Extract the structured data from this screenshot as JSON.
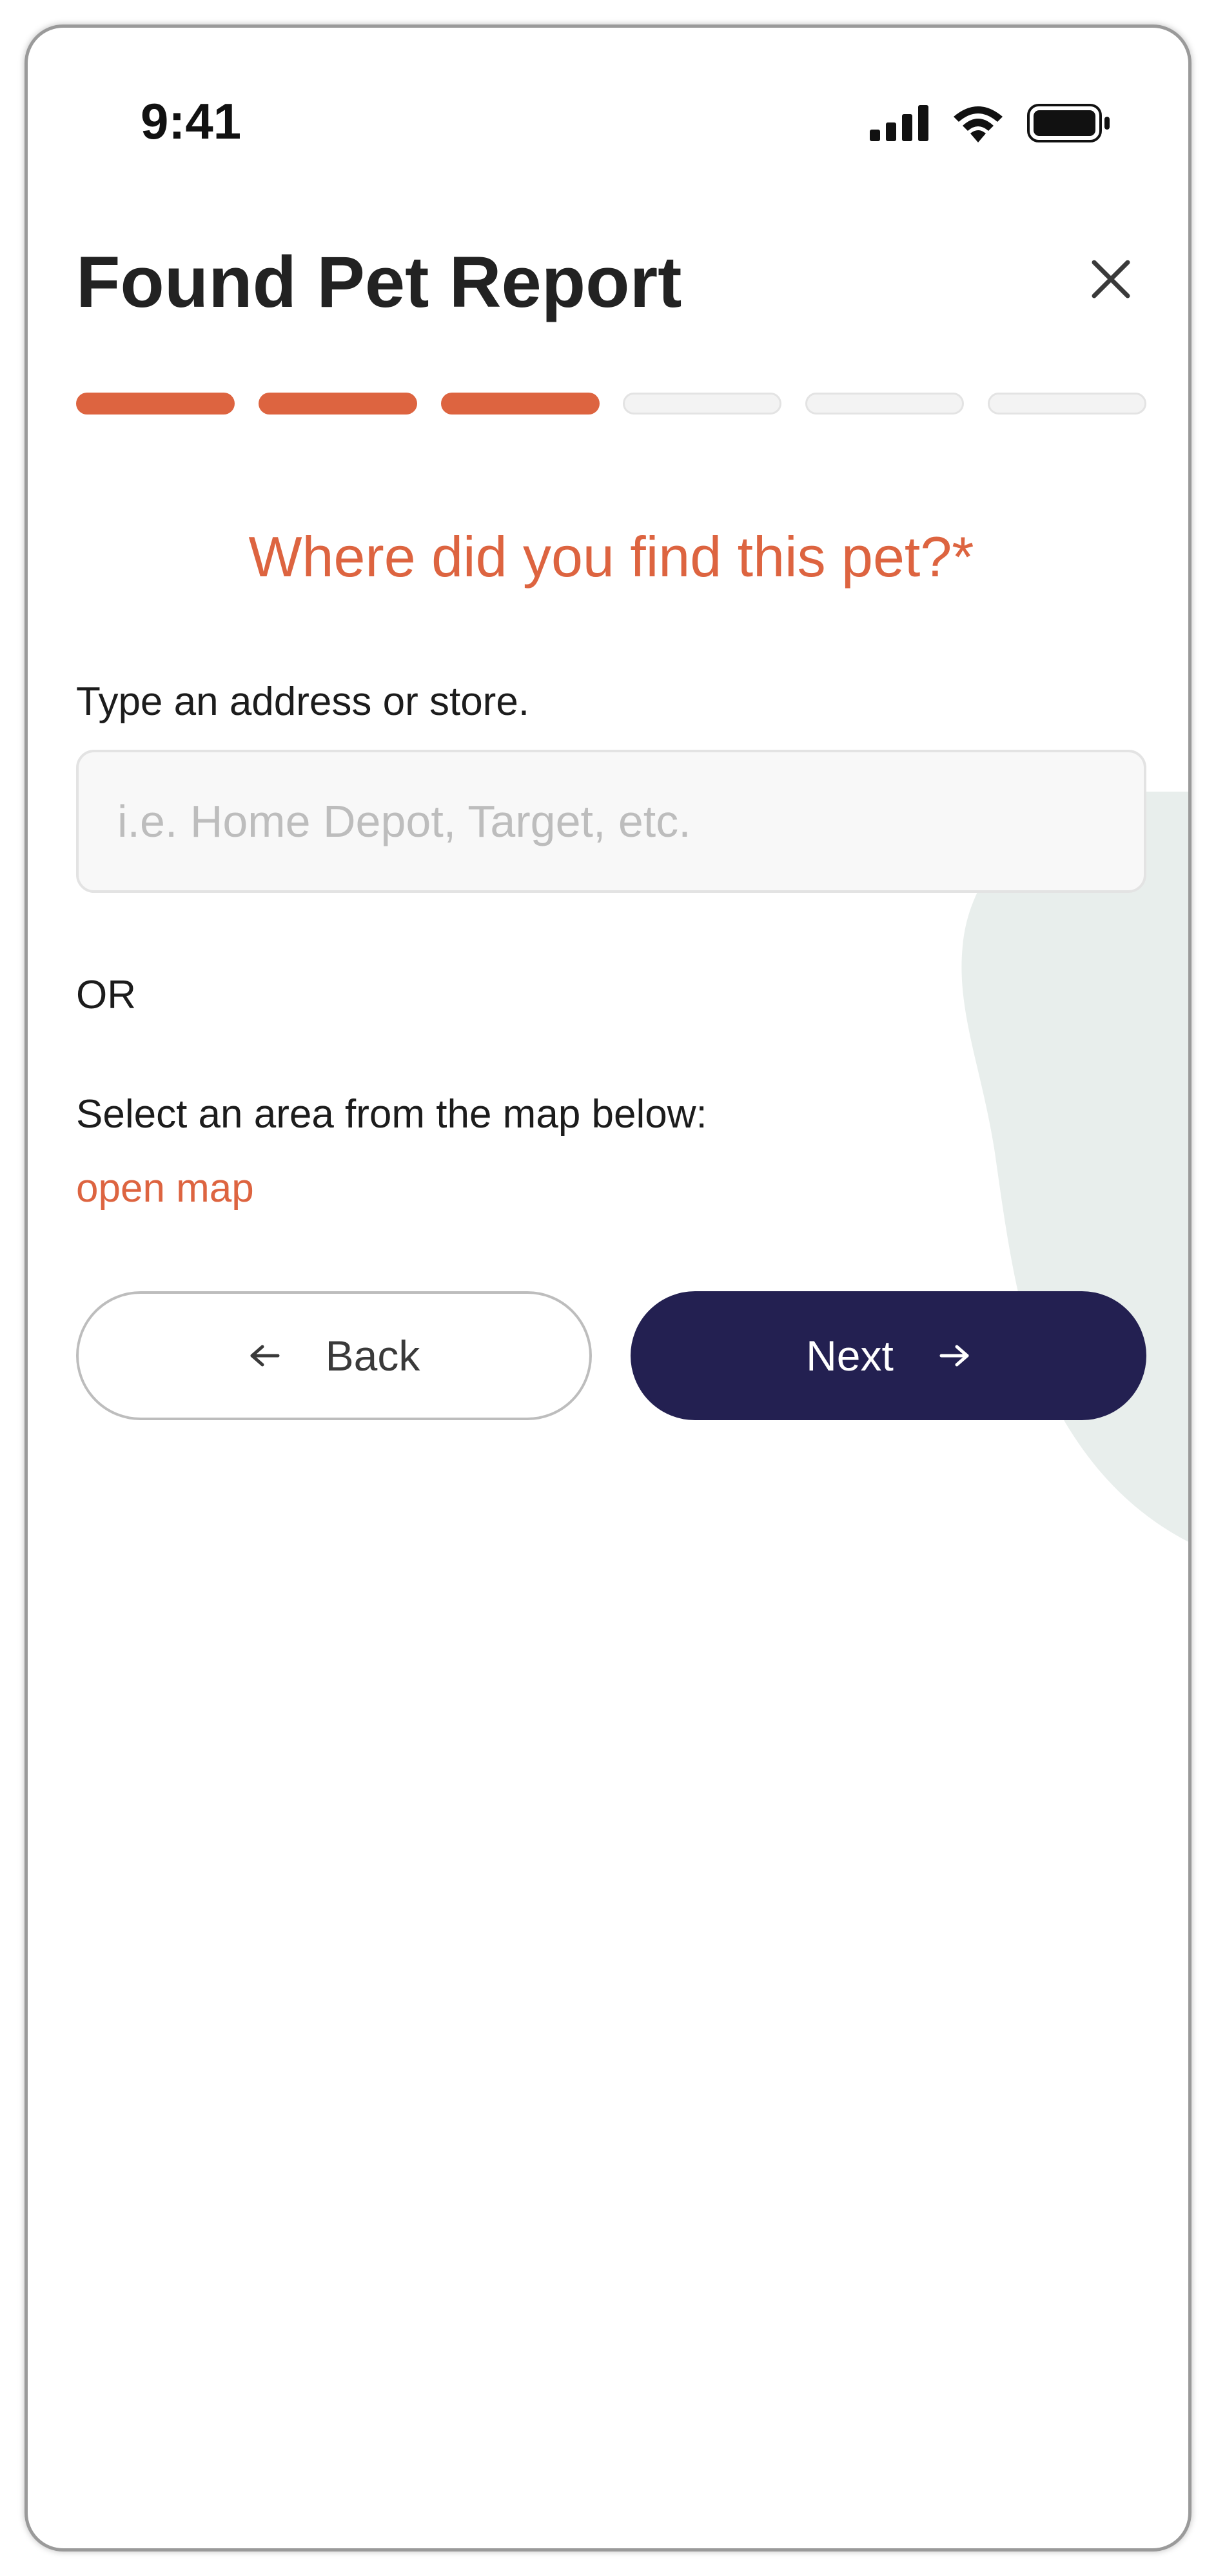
{
  "status_bar": {
    "time": "9:41",
    "icons": [
      "cellular-signal-icon",
      "wifi-icon",
      "battery-icon"
    ]
  },
  "header": {
    "title": "Found Pet Report",
    "close_icon": "close-icon"
  },
  "progress": {
    "total_steps": 6,
    "completed_steps": 3,
    "active_color": "#dd6440",
    "inactive_color": "#f3f3f3"
  },
  "form": {
    "question": "Where did you find this pet?*",
    "address_label": "Type an address or store.",
    "address_placeholder": "i.e. Home Depot, Target, etc.",
    "address_value": "",
    "or_text": "OR",
    "map_label": "Select an area from the map below:",
    "map_link": "open map"
  },
  "actions": {
    "back_label": "Back",
    "back_icon": "arrow-left-icon",
    "next_label": "Next",
    "next_icon": "arrow-right-icon"
  },
  "colors": {
    "accent": "#dd6440",
    "primary_button": "#232051",
    "decorative_blob": "#e8eeec"
  }
}
